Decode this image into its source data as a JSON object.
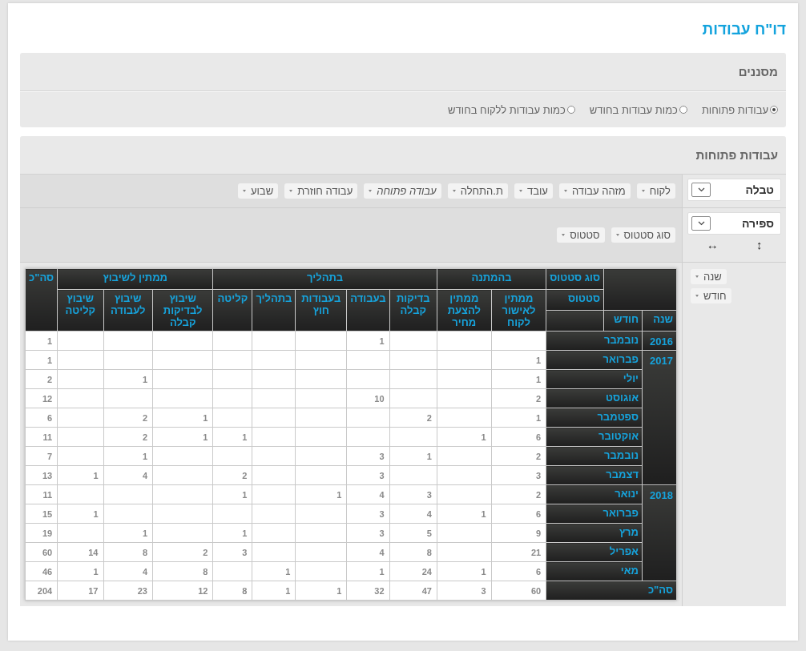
{
  "page_title": "דו\"ח עבודות",
  "filters": {
    "title": "מסננים",
    "options": [
      {
        "label": "עבודות פתוחות",
        "selected": true
      },
      {
        "label": "כמות עבודות בחודש",
        "selected": false
      },
      {
        "label": "כמות עבודות ללקוח בחודש",
        "selected": false
      }
    ]
  },
  "pivot": {
    "title": "עבודות פתוחות",
    "renderer": "טבלה",
    "aggregator": "ספירה",
    "row_order": "↕",
    "col_order": "↔",
    "unused_fields": [
      {
        "label": "לקוח",
        "filtered": false
      },
      {
        "label": "מזהה עבודה",
        "filtered": false
      },
      {
        "label": "עובד",
        "filtered": false
      },
      {
        "label": "ת.התחלה",
        "filtered": false
      },
      {
        "label": "עבודה פתוחה",
        "filtered": true
      },
      {
        "label": "עבודה חוזרת",
        "filtered": false
      },
      {
        "label": "שבוע",
        "filtered": false
      }
    ],
    "column_fields": [
      "סוג סטטוס",
      "סטטוס"
    ],
    "row_fields": [
      "שנה",
      "חודש"
    ],
    "table": {
      "col_axis_labels": [
        "סוג סטטוס",
        "סטטוס"
      ],
      "row_axis_labels": [
        "שנה",
        "חודש"
      ],
      "groups": [
        {
          "label": "בהמתנה",
          "columns": [
            "ממתין לאישור לקוח",
            "ממתין להצעת מחיר"
          ]
        },
        {
          "label": "בתהליך",
          "columns": [
            "בדיקות קבלה",
            "בעבודה",
            "בעבודות חוץ",
            "בתהליך",
            "קליטה"
          ]
        },
        {
          "label": "ממתין לשיבוץ",
          "columns": [
            "שיבוץ לבדיקות קבלה",
            "שיבוץ לעבודה",
            "שיבוץ קליטה"
          ]
        }
      ],
      "total_column_label": "סה\"כ",
      "years": [
        {
          "year": "2016",
          "months": [
            {
              "month": "נובמבר",
              "values": {
                "column_4": "1",
                "total": "1"
              }
            }
          ]
        },
        {
          "year": "2017",
          "months": [
            {
              "month": "פברואר",
              "values": {
                "column_1": "1",
                "total": "1"
              }
            },
            {
              "month": "יולי",
              "values": {
                "column_1": "1",
                "column_9": "1",
                "total": "2"
              }
            },
            {
              "month": "אוגוסט",
              "values": {
                "column_1": "2",
                "column_4": "10",
                "total": "12"
              }
            },
            {
              "month": "ספטמבר",
              "values": {
                "column_1": "1",
                "column_3": "2",
                "column_8": "1",
                "column_9": "2",
                "total": "6"
              }
            },
            {
              "month": "אוקטובר",
              "values": {
                "column_1": "6",
                "column_2": "1",
                "column_7": "1",
                "column_8": "1",
                "column_9": "2",
                "total": "11"
              }
            },
            {
              "month": "נובמבר",
              "values": {
                "column_1": "2",
                "column_3": "1",
                "column_4": "3",
                "column_9": "1",
                "total": "7"
              }
            },
            {
              "month": "דצמבר",
              "values": {
                "column_1": "3",
                "column_4": "3",
                "column_7": "2",
                "column_9": "4",
                "column_10": "1",
                "total": "13"
              }
            }
          ]
        },
        {
          "year": "2018",
          "months": [
            {
              "month": "ינואר",
              "values": {
                "column_1": "2",
                "column_3": "3",
                "column_4": "4",
                "column_5": "1",
                "column_7": "1",
                "total": "11"
              }
            },
            {
              "month": "פברואר",
              "values": {
                "column_1": "6",
                "column_2": "1",
                "column_3": "4",
                "column_4": "3",
                "column_10": "1",
                "total": "15"
              }
            },
            {
              "month": "מרץ",
              "values": {
                "column_1": "9",
                "column_3": "5",
                "column_4": "3",
                "column_7": "1",
                "column_9": "1",
                "total": "19"
              }
            },
            {
              "month": "אפריל",
              "values": {
                "column_1": "21",
                "column_3": "8",
                "column_4": "4",
                "column_7": "3",
                "column_8": "2",
                "column_9": "8",
                "column_10": "14",
                "total": "60"
              }
            },
            {
              "month": "מאי",
              "values": {
                "column_1": "6",
                "column_2": "1",
                "column_3": "24",
                "column_4": "1",
                "column_6": "1",
                "column_8": "8",
                "column_9": "4",
                "column_10": "1",
                "total": "46"
              }
            }
          ]
        }
      ],
      "totals_row_label": "סה\"כ",
      "totals": {
        "column_1": "60",
        "column_2": "3",
        "column_3": "47",
        "column_4": "32",
        "column_5": "1",
        "column_6": "1",
        "column_7": "8",
        "column_8": "12",
        "column_9": "23",
        "column_10": "17",
        "total": "204"
      }
    }
  }
}
